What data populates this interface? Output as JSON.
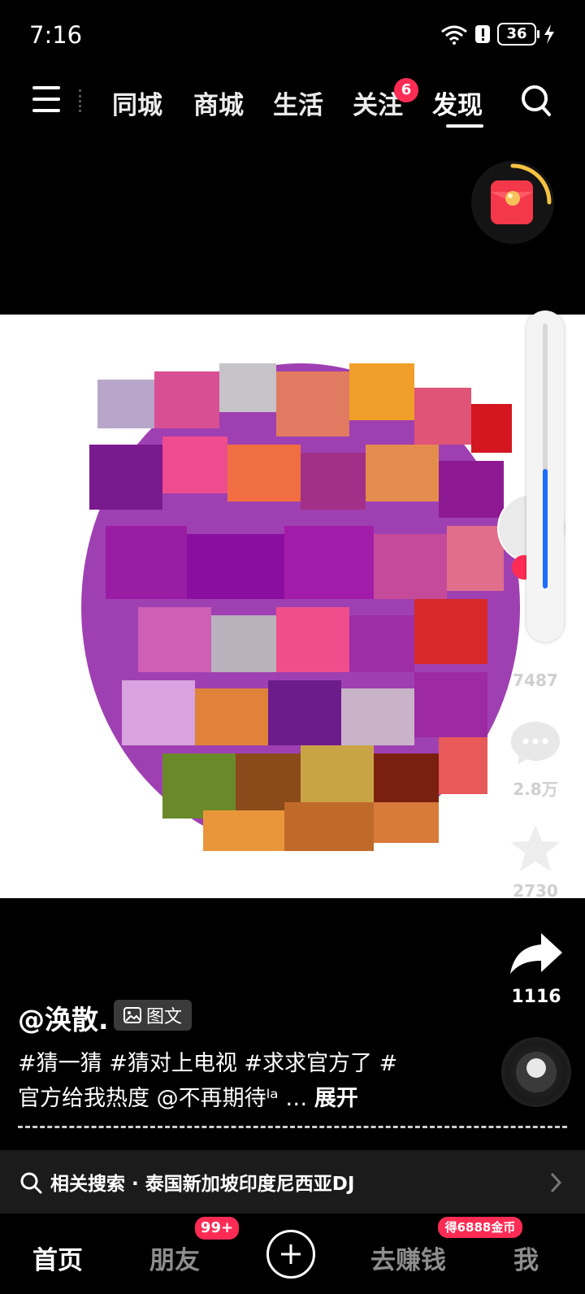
{
  "status": {
    "time": "7:16",
    "battery": "36",
    "icons": [
      "wifi-icon",
      "alert-icon",
      "battery-icon",
      "charging-icon"
    ]
  },
  "top_nav": {
    "menu_icon": "menu-icon",
    "tabs": [
      {
        "label": "同城"
      },
      {
        "label": "商城"
      },
      {
        "label": "生活"
      },
      {
        "label": "关注",
        "badge": "6"
      },
      {
        "label": "发现",
        "active": true
      }
    ],
    "search_icon": "search-icon"
  },
  "post": {
    "author": "@涣散.",
    "type_label": "图文",
    "caption_line1": "#猜一猜 #猜对上电视 #求求官方了 #",
    "caption_line2": "官方给我热度 @不再期待ˡᵃ … ",
    "expand_label": "展开"
  },
  "right_rail": {
    "like_count": "7487",
    "comment_count": "2.8万",
    "favorite_count": "2730",
    "share_count": "1116"
  },
  "volume": {
    "level": 0.45
  },
  "related_search": {
    "label": "相关搜索 · 泰国新加坡印度尼西亚DJ"
  },
  "bottom_nav": {
    "home": "首页",
    "friends": "朋友",
    "friends_badge": "99+",
    "earn": "去赚钱",
    "earn_badge": "得6888金币",
    "me": "我"
  },
  "colors": {
    "accent": "#fe2c55",
    "volume_fill": "#1e6bff",
    "background": "#000000"
  }
}
